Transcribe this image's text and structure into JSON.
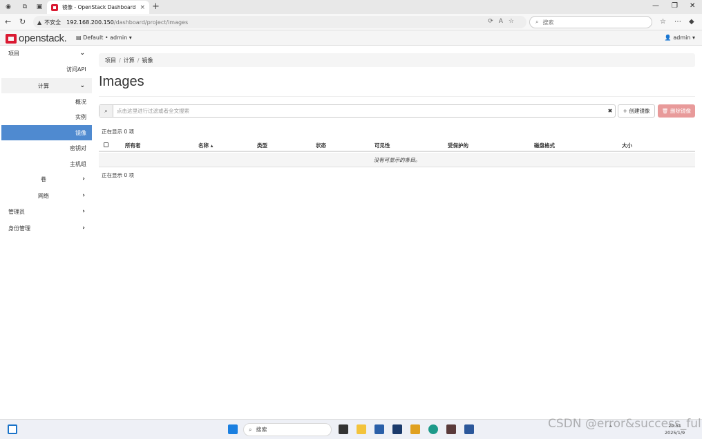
{
  "browser": {
    "tab_title": "镜像 - OpenStack Dashboard",
    "tab_close": "×",
    "new_tab": "+",
    "insecure_label": "不安全",
    "url_host": "192.168.200.150",
    "url_path": "/dashboard/project/images",
    "search_placeholder": "搜索",
    "win_min": "—",
    "win_max": "❐",
    "win_close": "✕"
  },
  "header": {
    "logo_text": "openstack.",
    "project_selector": "Default • admin ▾",
    "user_menu": "admin ▾"
  },
  "sidebar": {
    "project": "项目",
    "api_access": "访问API",
    "compute": "计算",
    "overview": "概况",
    "instances": "实例",
    "images": "镜像",
    "keypairs": "密钥对",
    "server_groups": "主机组",
    "volumes": "卷",
    "network": "网络",
    "admin": "管理员",
    "identity": "身份管理"
  },
  "breadcrumb": [
    "项目",
    "计算",
    "镜像"
  ],
  "page": {
    "title": "Images",
    "filter_placeholder": "点击这里进行过滤或者全文搜索",
    "create_button": "+ 创建镜像",
    "delete_button": "🗑 删除镜像",
    "count_top": "正在显示 0 项",
    "count_bottom": "正在显示 0 项",
    "empty_message": "没有可显示的条目。"
  },
  "table": {
    "columns": [
      "所有者",
      "名称 ▴",
      "类型",
      "状态",
      "可见性",
      "受保护的",
      "磁盘格式",
      "大小"
    ]
  },
  "taskbar": {
    "search_placeholder": "搜索",
    "clock_time": "20:51",
    "clock_date": "2025/1/9"
  },
  "watermark": "CSDN @error&success_ful",
  "colors": {
    "brand_red": "#da1a32",
    "active_nav": "#4f8ad0",
    "delete_button": "#e89a9a"
  }
}
